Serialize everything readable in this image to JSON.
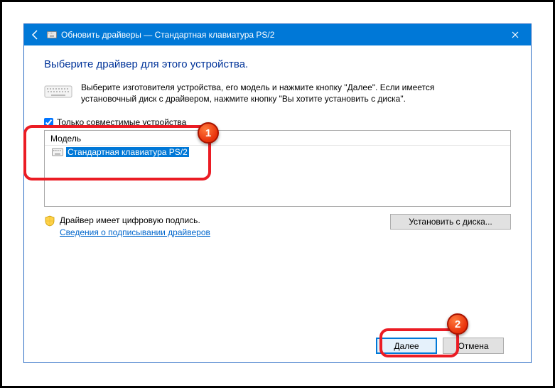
{
  "titlebar": {
    "title": "Обновить драйверы — Стандартная клавиатура PS/2"
  },
  "header": {
    "heading": "Выберите драйвер для этого устройства."
  },
  "instructions": {
    "line1": "Выберите изготовителя устройства, его модель и нажмите кнопку \"Далее\". Если имеется",
    "line2": "установочный диск с драйвером, нажмите кнопку \"Вы хотите установить с диска\"."
  },
  "compat": {
    "label": "Только совместимые устройства",
    "checked": true
  },
  "list": {
    "header": "Модель",
    "items": [
      {
        "label": "Стандартная клавиатура PS/2",
        "selected": true
      }
    ]
  },
  "signature": {
    "text": "Драйвер имеет цифровую подпись.",
    "link": "Сведения о подписывании драйверов",
    "disk_button": "Установить с диска..."
  },
  "footer": {
    "next": "Далее",
    "cancel": "Отмена"
  },
  "annotations": {
    "marker1": "1",
    "marker2": "2"
  }
}
